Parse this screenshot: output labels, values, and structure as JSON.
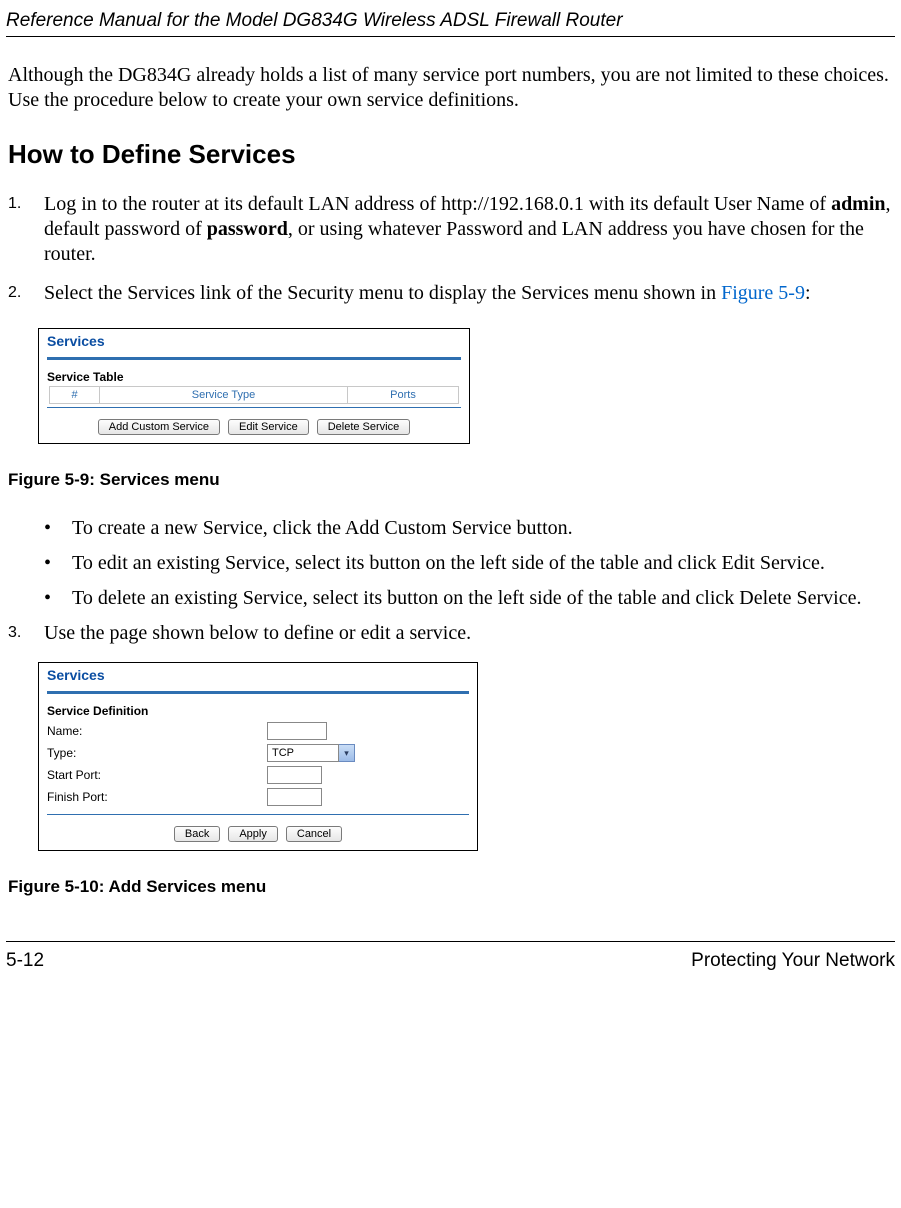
{
  "header": {
    "title": "Reference Manual for the Model DG834G Wireless ADSL Firewall Router"
  },
  "intro": "Although the DG834G already holds a list of many service port numbers, you are not limited to these choices. Use the procedure below to create your own service definitions.",
  "h2": "How to Define Services",
  "steps": {
    "s1": {
      "num": "1.",
      "pre": "Log in to the router at its default LAN address of http://192.168.0.1 with its default User Name of ",
      "b1": "admin",
      "mid": ", default password of ",
      "b2": "password",
      "post": ", or using whatever Password and LAN address you have chosen for the router."
    },
    "s2": {
      "num": "2.",
      "pre": "Select the Services link of the Security menu to display the Services menu shown in ",
      "link": "Figure 5-9",
      "post": ":"
    },
    "s3": {
      "num": "3.",
      "text": "Use the page shown below to define or edit a service."
    }
  },
  "fig1": {
    "title": "Services",
    "subtitle": "Service Table",
    "columns": {
      "num": "#",
      "type": "Service Type",
      "ports": "Ports"
    },
    "buttons": {
      "add": "Add Custom Service",
      "edit": "Edit Service",
      "del": "Delete Service"
    },
    "caption": "Figure 5-9:  Services menu"
  },
  "bullets": {
    "b1": "To create a new Service, click the Add Custom Service button.",
    "b2": "To edit an existing Service, select its button on the left side of the table and click Edit Service.",
    "b3": "To delete an existing Service, select its button on the left side of the table and click Delete Service."
  },
  "fig2": {
    "title": "Services",
    "subtitle": "Service Definition",
    "rows": {
      "name": "Name:",
      "type": "Type:",
      "start": "Start Port:",
      "finish": "Finish Port:"
    },
    "type_value": "TCP",
    "buttons": {
      "back": "Back",
      "apply": "Apply",
      "cancel": "Cancel"
    },
    "caption": "Figure 5-10:  Add Services menu"
  },
  "footer": {
    "page": "5-12",
    "section": "Protecting Your Network"
  }
}
